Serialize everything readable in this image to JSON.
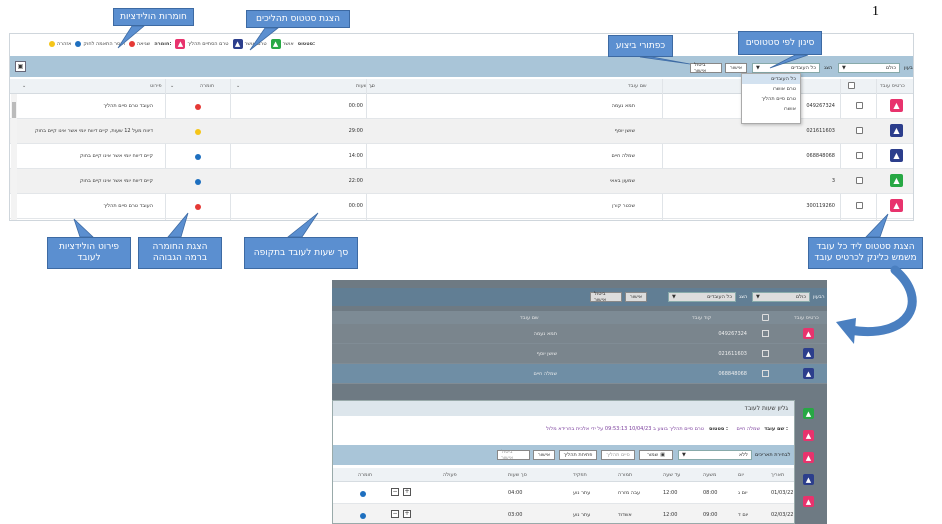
{
  "page_number": "1",
  "legend": {
    "status_label": "סטטוס:",
    "items": [
      {
        "label": "אושר",
        "color": "#27a844",
        "kind": "badge-a"
      },
      {
        "label": "טרם אושר",
        "color": "#2c3e8c",
        "kind": "badge-u"
      },
      {
        "label": "טרם הסתיים תהליך",
        "color": "#e8336d",
        "kind": "badge-p"
      }
    ],
    "colors_label": "חומרה:",
    "colors": [
      {
        "label": "שגיאה",
        "color": "#e53935"
      },
      {
        "label": "חוסר התאמה לחוק",
        "color": "#1e6fbf"
      },
      {
        "label": "אזהרה",
        "color": "#f5c518"
      }
    ]
  },
  "toolbar": {
    "year_label": "רבעון",
    "year_value": "כולם",
    "status_filter_label": "הצג",
    "status_filter_value": "כל העובדים",
    "approve_btn": "אישור",
    "cancel_approve_btn": "ביטול אישור"
  },
  "status_dropdown": {
    "options": [
      "כל העובדים",
      "טרם אושרו",
      "טרם סיים תהליך",
      "אושרו"
    ]
  },
  "columns": {
    "employee_card": "כרטיס עובד",
    "employee_code": "קוד עובד",
    "employee_name": "שם עובד",
    "total_hours": "סך שעות",
    "severity": "חומרה",
    "details": "פירוט"
  },
  "rows": [
    {
      "status": "badge-p",
      "code": "049267324",
      "name": "תמא נעמה",
      "hours": "00:00",
      "severity": "#e53935",
      "details": "העובד טרם סיים תהליך"
    },
    {
      "status": "badge-u",
      "code": "021611603",
      "name": "שושן יוסף",
      "hours": "29:00",
      "severity": "#f5c518",
      "details": "דיווח מעל 12 שעות, קיים דיווח יומי אשר אינו קיים בחוק"
    },
    {
      "status": "badge-u",
      "code": "068848068",
      "name": "שמלה חיים",
      "hours": "14:00",
      "severity": "#1e6fbf",
      "details": "קיים דיווח יומי אשר אינו קיים בחוק"
    },
    {
      "status": "badge-a",
      "code": "3",
      "name": "שמעון באאי",
      "hours": "22:00",
      "severity": "#1e6fbf",
      "details": "קיים דיווח יומי אשר אינו קיים בחוק"
    },
    {
      "status": "badge-p",
      "code": "300119260",
      "name": "שכטר קורן",
      "hours": "00:00",
      "severity": "#e53935",
      "details": "העובד טרם סיים תהליך"
    }
  ],
  "callouts": {
    "status_colors": "חומרות הולידציות",
    "process_status": "הצגת סטטוס תהליכים",
    "action_buttons": "כפתורי ביצוע",
    "filter_by_status": "סינון לפי סטטוסים",
    "validation_details": "פירוט הולידציות לעובד",
    "severity_display": "הצגת החומרה ברמה הגבוהה",
    "total_hours": "סך שעות לעובד בתקופה",
    "status_per_employee": "הצגת סטטוס ליד כל עובד משמש כלינק לכרטיס עובד"
  },
  "shot2": {
    "rows": [
      {
        "code": "049267324",
        "name": "תמא נעמה",
        "status": "badge-p"
      },
      {
        "code": "021611603",
        "name": "שושן יוסף",
        "status": "badge-u"
      },
      {
        "code": "068848068",
        "name": "שמלה חיים",
        "status": "badge-u"
      }
    ]
  },
  "modal": {
    "title": "גליון שעות לעובד",
    "employee_name_label": "שם עובד :",
    "employee_name": "שמלה חיים",
    "status_label": "סטטוס :",
    "status_text": "טרם סיים תהליך בוצע ב 10/04/23 09:53:13 על ידי אלכית בחרידא מלול",
    "filter_label": "לבחירת תאריכים",
    "filter_value": "ללא",
    "save_btn": "שמור",
    "finish_btn": "סיים תהליך",
    "open_btn": "פתיחת תהליך",
    "approve_btn": "אישור",
    "cancel_btn": "ביטול אישור",
    "columns": [
      "תאריך",
      "יום",
      "משעה",
      "עד שעה",
      "תמורה",
      "תפקיד",
      "סך שעות",
      "פעולה",
      "חומרה"
    ],
    "rows": [
      [
        "01/03/22",
        "יום ג",
        "08:00",
        "12:00",
        "עבה מזרח",
        "עתר נוע",
        "04:00"
      ],
      [
        "02/03/22",
        "יום ד",
        "09:00",
        "12:00",
        "אשדוד",
        "עתר נוע",
        "03:00"
      ]
    ]
  }
}
